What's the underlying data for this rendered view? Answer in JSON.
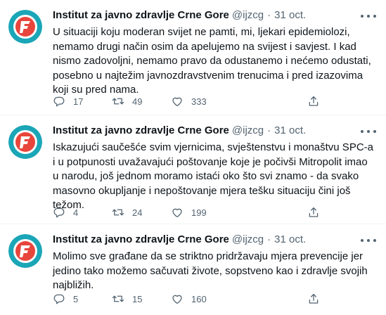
{
  "tweets": [
    {
      "author_name": "Institut za javno zdravlje Crne Gore",
      "handle": "@ijzcg",
      "separator": "·",
      "date": "31 oct.",
      "text": "U situaciji koju moderan svijet ne pamti, mi, ljekari epidemiolozi, nemamo drugi način osim da apelujemo na svijest i savjest. I kad nismo zadovoljni, nemamo pravo da odustanemo i nećemo odustati, posebno u najtežim javnozdravstvenim trenucima i pred izazovima koji su pred nama.",
      "replies": "17",
      "retweets": "49",
      "likes": "333"
    },
    {
      "author_name": "Institut za javno zdravlje Crne Gore",
      "handle": "@ijzcg",
      "separator": "·",
      "date": "31 oct.",
      "text": "Iskazujući saučešće svim vjernicima, svještenstvu i monaštvu SPC-a i u potpunosti uvažavajući poštovanje koje je počivši Mitropolit imao u narodu, još jednom moramo istaći oko što svi znamo - da svako masovno okupljanje i nepoštovanje mjera tešku situaciju čini još težom.",
      "replies": "4",
      "retweets": "24",
      "likes": "199"
    },
    {
      "author_name": "Institut za javno zdravlje Crne Gore",
      "handle": "@ijzcg",
      "separator": "·",
      "date": "31 oct.",
      "text": "Molimo sve građane da se striktno pridržavaju mjera prevencije jer jedino tako možemo sačuvati živote, sopstveno kao i zdravlje svojih najbližih.",
      "replies": "5",
      "retweets": "15",
      "likes": "160"
    }
  ],
  "icons": {
    "reply": "reply-icon",
    "retweet": "retweet-icon",
    "like": "heart-icon",
    "share": "share-icon",
    "more": "more-icon"
  },
  "colors": {
    "text": "#0f1419",
    "secondary": "#536471",
    "divider": "#eff3f4",
    "avatar_ring": "#1aa6b7",
    "avatar_inner": "#e8453c"
  }
}
